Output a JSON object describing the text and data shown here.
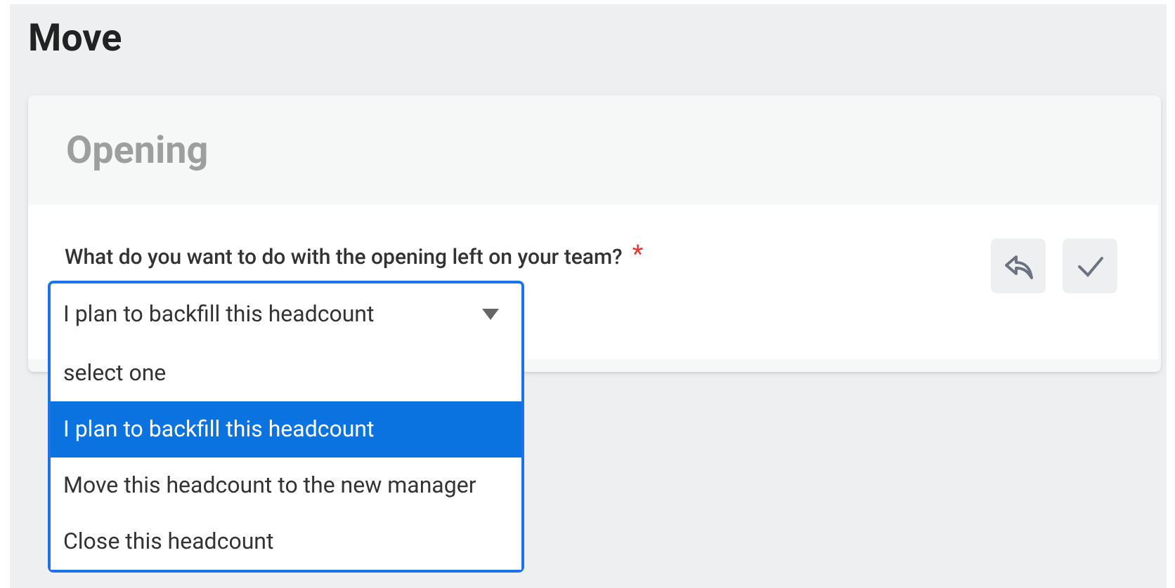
{
  "page_title": "Move",
  "card": {
    "title": "Opening",
    "question": {
      "label": "What do you want to do with the opening left on your team?",
      "required_mark": "*"
    },
    "dropdown": {
      "value": "I plan to backfill this headcount",
      "expanded": true,
      "options": [
        {
          "label": "select one",
          "selected": false
        },
        {
          "label": "I plan to backfill this headcount",
          "selected": true
        },
        {
          "label": "Move this headcount to the new manager",
          "selected": false
        },
        {
          "label": "Close this headcount",
          "selected": false
        }
      ]
    },
    "actions": [
      {
        "kind": "undo"
      },
      {
        "kind": "confirm"
      }
    ]
  }
}
